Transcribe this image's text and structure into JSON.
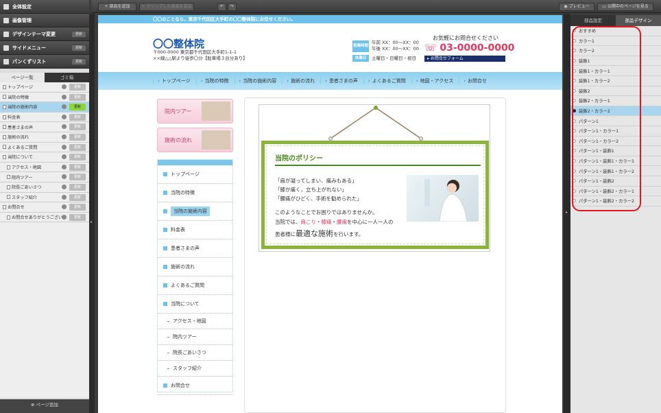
{
  "left_panel": {
    "menu": [
      {
        "label": "全体設定",
        "btn": ""
      },
      {
        "label": "画像管理",
        "btn": ""
      },
      {
        "label": "デザインテーマ変更",
        "btn": "更新"
      },
      {
        "label": "サイドメニュー",
        "btn": "更新"
      },
      {
        "label": "パンくずリスト",
        "btn": "更新"
      }
    ],
    "tabs": [
      "ページ一覧",
      "ゴミ箱"
    ],
    "pages": [
      {
        "label": "トップページ",
        "indent": false,
        "btn": "更新"
      },
      {
        "label": "当院の特徴",
        "indent": false,
        "btn": "更新"
      },
      {
        "label": "当院の施術内容",
        "indent": false,
        "btn": "更新"
      },
      {
        "label": "料金表",
        "indent": false,
        "btn": "更新"
      },
      {
        "label": "患者さまの声",
        "indent": false,
        "btn": "更新"
      },
      {
        "label": "施術の流れ",
        "indent": false,
        "btn": "更新"
      },
      {
        "label": "よくあるご質問",
        "indent": false,
        "btn": "更新"
      },
      {
        "label": "当院について",
        "indent": false,
        "btn": "更新"
      },
      {
        "label": "アクセス・地図",
        "indent": true,
        "btn": "更新"
      },
      {
        "label": "院内ツアー",
        "indent": true,
        "btn": "更新"
      },
      {
        "label": "院長ごあいさつ",
        "indent": true,
        "btn": "更新"
      },
      {
        "label": "スタッフ紹介",
        "indent": true,
        "btn": "更新"
      },
      {
        "label": "お問合せ",
        "indent": false,
        "btn": "更新"
      },
      {
        "label": "お問合せありがとうござい",
        "indent": true,
        "btn": "更新"
      }
    ],
    "add_page": "ページ追加"
  },
  "toolbar": {
    "add_part": "部品を追加",
    "add_clip": "クリップした部品を追加",
    "undo": "↶",
    "redo": "↷",
    "preview": "プレビュー",
    "view_published": "公開中のページを見る"
  },
  "site": {
    "strip": "〇〇のことなら、東京千代田区大手町の〇〇整体院にお任せください。",
    "logo": "〇〇整体院",
    "addr1": "〒000-0000 東京都千代田区大手町1-1-1",
    "addr2": "××線△△駅より徒歩〇分【駐車場３台分あり】",
    "hours_badge": "営業時間",
    "hours1": "午前 XX：00〜XX：00",
    "hours2": "午後 XX：00〜XX：00",
    "closed_badge": "休業日",
    "closed": "土曜日・日曜日・祝日",
    "inquiry": "お気軽にお問合せください",
    "tel": "03-0000-0000",
    "form_btn": "お問合せフォーム",
    "gnav": [
      "トップページ",
      "当院の特徴",
      "当院の施術内容",
      "施術の流れ",
      "患者さまの声",
      "よくあるご質問",
      "地図・アクセス",
      "お問合せ"
    ],
    "banner1": "院内ツアー",
    "banner2": "施術の流れ",
    "sidenav": [
      {
        "label": "トップページ",
        "sub": false
      },
      {
        "label": "当院の特徴",
        "sub": false
      },
      {
        "label": "当院の施術内容",
        "sub": false,
        "active": true
      },
      {
        "label": "料金表",
        "sub": false
      },
      {
        "label": "患者さまの声",
        "sub": false
      },
      {
        "label": "施術の流れ",
        "sub": false
      },
      {
        "label": "よくあるご質問",
        "sub": false
      },
      {
        "label": "当院について",
        "sub": false
      },
      {
        "label": "アクセス・地図",
        "sub": true
      },
      {
        "label": "院内ツアー",
        "sub": true
      },
      {
        "label": "院長ごあいさつ",
        "sub": true
      },
      {
        "label": "スタッフ紹介",
        "sub": true
      },
      {
        "label": "お問合せ",
        "sub": false
      }
    ],
    "policy_title": "当院のポリシー",
    "policy_lines": [
      "「肩が凝ってしまい、痛みもある」",
      "「膝が痛く、立ち上がれない」",
      "「腰痛がひどく、手術を勧められた」"
    ],
    "policy_p1": "このようなことでお困りではありませんか。",
    "policy_p2a": "当院では、",
    "policy_red1": "肩こり",
    "policy_sep1": "・",
    "policy_red2": "膝痛",
    "policy_sep2": "・",
    "policy_red3": "腰痛",
    "policy_p2b": "を中心に一人一人の",
    "policy_p3a": "患者様に",
    "policy_big": "最適な施術",
    "policy_p3b": "を行います。"
  },
  "right_panel": {
    "tabs": [
      "部品設定",
      "部品デザイン"
    ],
    "items": [
      "おすすめ",
      "カラー1",
      "カラー2",
      "装飾1",
      "装飾1・カラー1",
      "装飾1・カラー2",
      "装飾2",
      "装飾2・カラー1",
      "装飾2・カラー2",
      "パターン1",
      "パターン1・カラー1",
      "パターン1・カラー2",
      "パターン1・装飾1",
      "パターン1・装飾1・カラー1",
      "パターン1・装飾1・カラー2",
      "パターン1・装飾2",
      "パターン1・装飾2・カラー1",
      "パターン1・装飾2・カラー2"
    ],
    "selected": "装飾2・カラー2"
  },
  "colors": {
    "accent": "#6ec1ea",
    "highlight": "#e8131a",
    "green": "#4a8a1e",
    "tel": "#e8365e"
  }
}
